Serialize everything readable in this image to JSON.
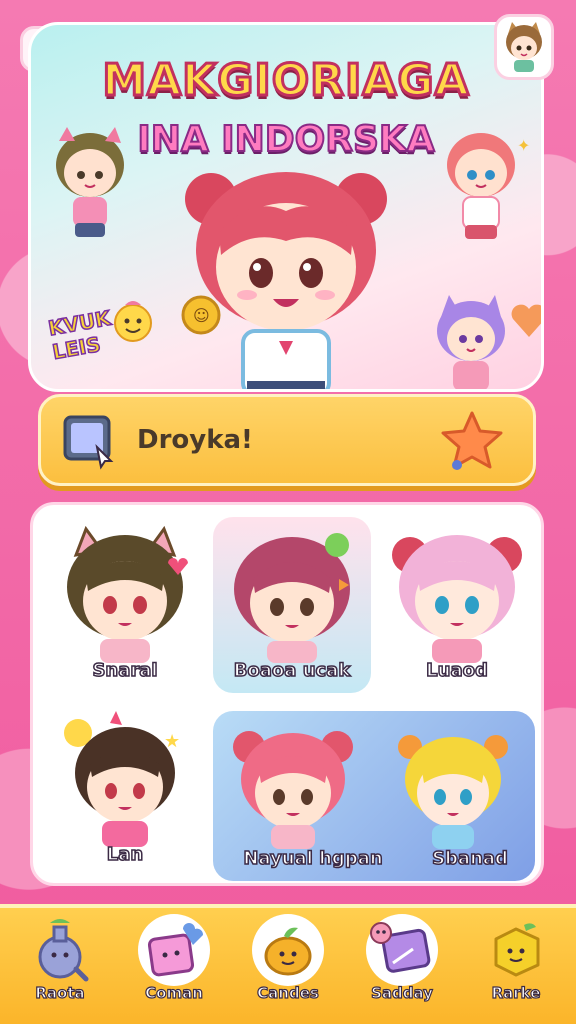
{
  "header": {
    "title": "MAKGIORIAGA",
    "subtitle": "INA INDORSKA",
    "sticker_text_line1": "KVUK",
    "sticker_text_line2": "LEIS"
  },
  "banner": {
    "text": "Droyka!"
  },
  "characters": [
    {
      "label": "Snaral"
    },
    {
      "label": "Boaoa ucak"
    },
    {
      "label": "Luaod"
    },
    {
      "label": "Lan"
    },
    {
      "label": "Nayual hgpan"
    },
    {
      "label": "Sbanad"
    }
  ],
  "nav": [
    {
      "label": "Raota",
      "icon": "potion-icon"
    },
    {
      "label": "Coman",
      "icon": "gift-icon"
    },
    {
      "label": "Candes",
      "icon": "fruit-icon"
    },
    {
      "label": "Sadday",
      "icon": "tag-icon"
    },
    {
      "label": "Rarke",
      "icon": "block-icon"
    }
  ],
  "colors": {
    "background": "#f26aa8",
    "banner": "#fbbf3f",
    "nav": "#ffcf4f",
    "title": "#ffd84a"
  }
}
